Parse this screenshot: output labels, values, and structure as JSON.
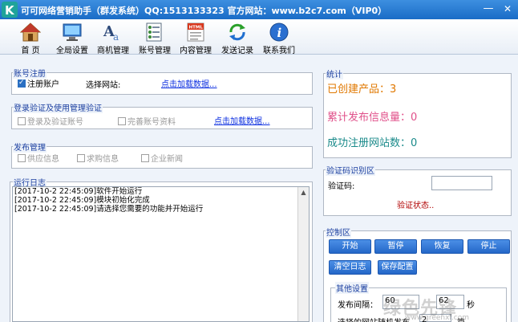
{
  "window": {
    "title": "可可网络营销助手（群发系统）QQ:1513133323 官方网站：www.b2c7.com（VIP0）",
    "min_label": "—",
    "close_label": "✕",
    "logo_letter": "K"
  },
  "toolbar": {
    "items": [
      {
        "label": "首 页",
        "icon": "home-icon"
      },
      {
        "label": "全局设置",
        "icon": "monitor-settings-icon"
      },
      {
        "label": "商机管理",
        "icon": "font-aa-icon"
      },
      {
        "label": "账号管理",
        "icon": "account-list-icon"
      },
      {
        "label": "内容管理",
        "icon": "html-document-icon"
      },
      {
        "label": "发送记录",
        "icon": "refresh-arrows-icon"
      },
      {
        "label": "联系我们",
        "icon": "info-icon"
      }
    ]
  },
  "account_register": {
    "title": "账号注册",
    "register_checkbox": "注册账户",
    "register_checked": true,
    "select_site_label": "选择网站:",
    "load_link": "点击加载数据..."
  },
  "login_verify": {
    "title": "登录验证及使用管理验证",
    "login_checkbox": "登录及验证账号",
    "complete_checkbox": "完善账号资料",
    "load_link": "点击加载数据..."
  },
  "publish": {
    "title": "发布管理",
    "options": [
      "供应信息",
      "求购信息",
      "企业新闻"
    ]
  },
  "log": {
    "title": "运行日志",
    "lines": [
      "[2017-10-2 22:45:09]软件开始运行",
      "[2017-10-2 22:45:09]模块初始化完成",
      "[2017-10-2 22:45:09]请选择您需要的功能并开始运行"
    ]
  },
  "stats": {
    "title": "统计",
    "created_label": "已创建产品：3",
    "published_label": "累计发布信息量：0",
    "registered_label": "成功注册网站数：0",
    "colors": {
      "created": "#e07800",
      "published": "#e0508a",
      "registered": "#1a8a8a"
    }
  },
  "captcha": {
    "title": "验证码识别区",
    "code_label": "验证码:",
    "code_value": "",
    "status": "验证状态.."
  },
  "control": {
    "title": "控制区",
    "buttons": [
      "开始",
      "暂停",
      "恢复",
      "停止",
      "清空日志",
      "保存配置"
    ],
    "other_settings_title": "其他设置",
    "interval_label": "发布间隔：",
    "interval_min": "60",
    "interval_max": "62",
    "interval_unit": "秒",
    "random_label": "选择的网站随机发布",
    "random_value": "2",
    "random_unit": "篇"
  },
  "watermark": {
    "text": "绿色先锋",
    "sub": "www.greenxf.com"
  }
}
